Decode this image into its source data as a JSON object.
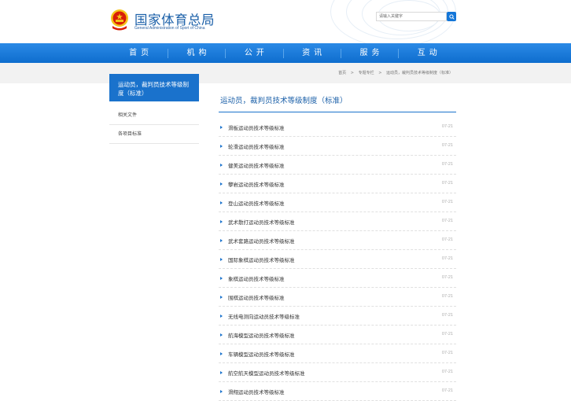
{
  "header": {
    "logo_cn": "国家体育总局",
    "logo_en": "General Administration of Sport of China",
    "emblem_icon": "national-emblem-icon",
    "search_placeholder": "请输入关键字",
    "search_icon": "search-icon"
  },
  "nav": {
    "items": [
      {
        "label": "首页"
      },
      {
        "label": "机构"
      },
      {
        "label": "公开"
      },
      {
        "label": "资讯"
      },
      {
        "label": "服务"
      },
      {
        "label": "互动"
      }
    ]
  },
  "breadcrumb": {
    "items": [
      "首页",
      "专题专栏",
      "运动员，裁判员技术等级制度（标准）"
    ],
    "separator": ">"
  },
  "sidebar": {
    "title": "运动员，裁判员技术等级制度（标准）",
    "items": [
      {
        "label": "相关文件"
      },
      {
        "label": "各项目标准"
      }
    ]
  },
  "main": {
    "title": "运动员，裁判员技术等级制度（标准）",
    "list": [
      {
        "title": "滑板运动员技术等级标准",
        "date": "07-21"
      },
      {
        "title": "轮滑运动员技术等级标准",
        "date": "07-21"
      },
      {
        "title": "健美运动员技术等级标准",
        "date": "07-21"
      },
      {
        "title": "攀岩运动员技术等级标准",
        "date": "07-21"
      },
      {
        "title": "登山运动员技术等级标准",
        "date": "07-21"
      },
      {
        "title": "武术散打运动员技术等级标准",
        "date": "07-21"
      },
      {
        "title": "武术套路运动员技术等级标准",
        "date": "07-21"
      },
      {
        "title": "国际象棋运动员技术等级标准",
        "date": "07-21"
      },
      {
        "title": "象棋运动员技术等级标准",
        "date": "07-21"
      },
      {
        "title": "围棋运动员技术等级标准",
        "date": "07-21"
      },
      {
        "title": "无线电测向运动员技术等级标准",
        "date": "07-21"
      },
      {
        "title": "航海模型运动员技术等级标准",
        "date": "07-21"
      },
      {
        "title": "车辆模型运动员技术等级标准",
        "date": "07-21"
      },
      {
        "title": "航空航天模型运动员技术等级标准",
        "date": "07-21"
      },
      {
        "title": "滑翔运动员技术等级标准",
        "date": "07-21"
      }
    ]
  },
  "colors": {
    "primary": "#1a72cc",
    "nav_top": "#2b8ae6",
    "nav_bottom": "#0e6dce",
    "logo_text": "#1a5fa8",
    "emblem_red": "#d81e06",
    "emblem_gold": "#f5c518"
  }
}
